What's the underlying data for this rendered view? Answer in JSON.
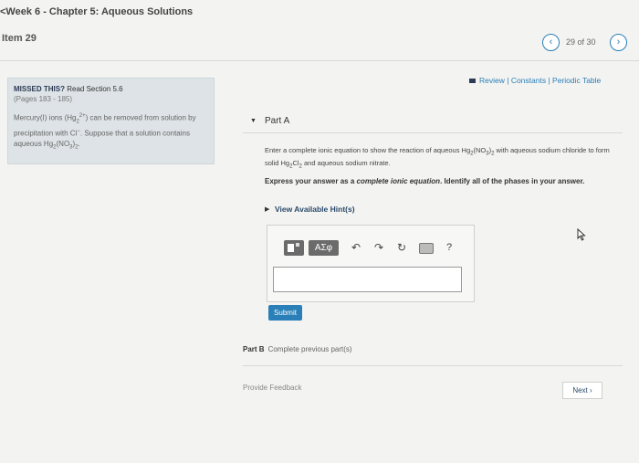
{
  "header": {
    "breadcrumb": "<Week 6 - Chapter 5: Aqueous Solutions",
    "item": "Item 29",
    "nav_prev": "‹",
    "nav_count": "29 of 30",
    "nav_next": "›"
  },
  "sidebar": {
    "missed_bold": "MISSED THIS?",
    "missed_rest": " Read Section 5.6",
    "pages": "(Pages 183 - 185)",
    "text_1": "Mercury(I) ions (Hg",
    "hg_sub": "2",
    "hg_sup": "2+",
    "text_2": ") can be removed from solution by precipitation with Cl",
    "cl_sup": "−",
    "text_3": ". Suppose that a solution contains aqueous Hg",
    "hg2_sub": "2",
    "text_4": "(NO",
    "no3_sub": "3",
    "text_5": ")",
    "paren_sub": "2",
    "text_6": "."
  },
  "links": {
    "review": "Review",
    "sep1": " | ",
    "constants": "Constants",
    "sep2": " | ",
    "periodic": "Periodic Table"
  },
  "part_a": {
    "caret": "▼",
    "label": "Part A",
    "question_1": "Enter a complete ionic equation to show the reaction of aqueous Hg",
    "q_hg_sub": "2",
    "question_2": "(NO",
    "q_no3_sub": "3",
    "question_3": ")",
    "q_paren_sub": "2",
    "question_4": " with aqueous sodium chloride to form solid Hg",
    "q_hg2_sub": "2",
    "question_5": "Cl",
    "q_cl_sub": "2",
    "question_6": " and aqueous sodium nitrate.",
    "express_1": "Express your answer as a ",
    "express_em": "complete ionic equation",
    "express_2": ". Identify all of the phases in your answer.",
    "hints_caret": "▶",
    "hints": "View Available Hint(s)",
    "greek": "ΑΣφ",
    "undo": "↶",
    "redo": "↷",
    "reset": "↻",
    "help": "?",
    "submit": "Submit"
  },
  "part_b": {
    "label": "Part B",
    "text": "Complete previous part(s)"
  },
  "footer": {
    "feedback": "Provide Feedback",
    "next": "Next ›"
  },
  "colors": {
    "accent": "#2a7fb8",
    "sidebar_bg": "#dde3e6"
  }
}
